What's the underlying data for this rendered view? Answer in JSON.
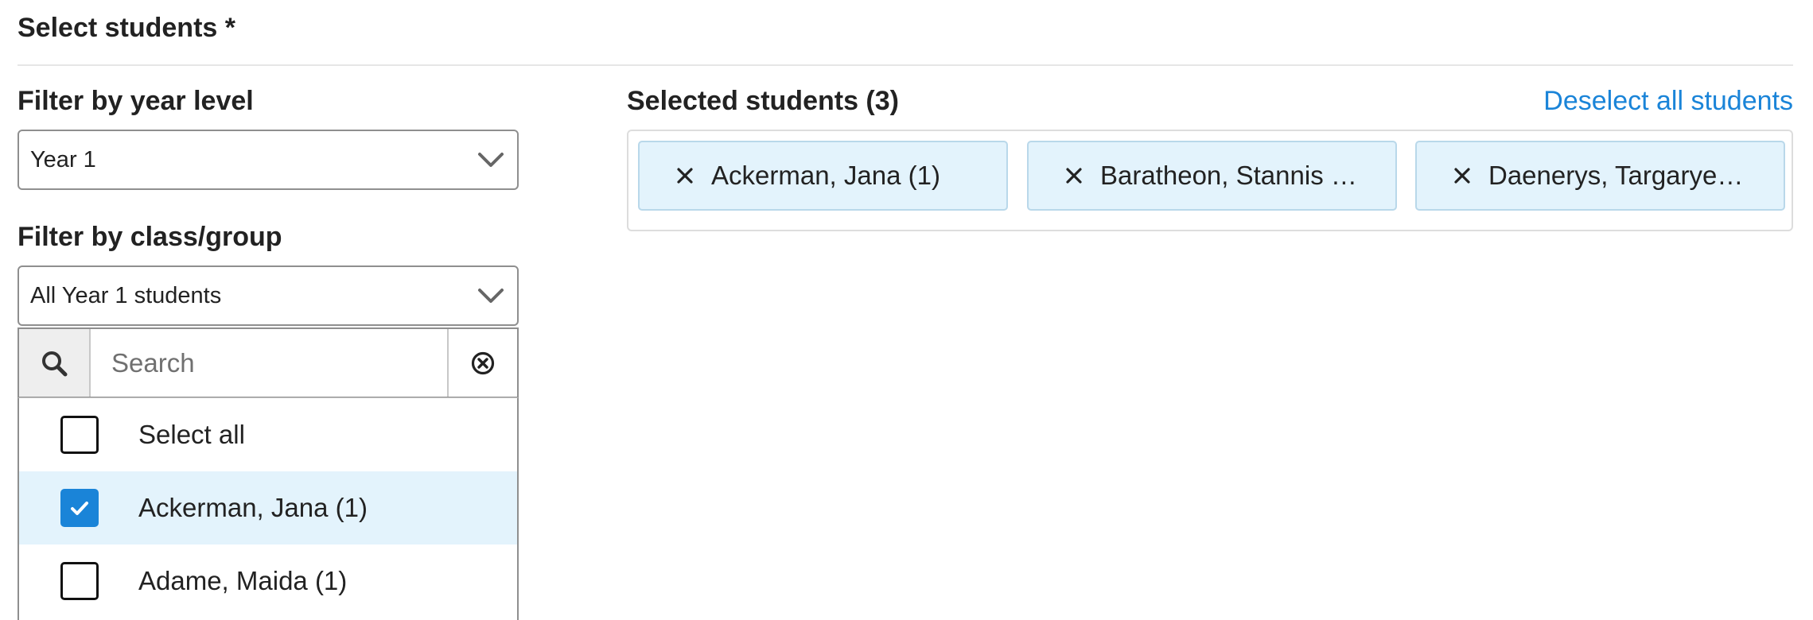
{
  "section": {
    "title": "Select students *"
  },
  "year_filter": {
    "label": "Filter by year level",
    "value": "Year 1"
  },
  "class_filter": {
    "label": "Filter by class/group",
    "value": "All Year 1 students"
  },
  "search": {
    "placeholder": "Search",
    "value": ""
  },
  "student_list": {
    "items": [
      {
        "label": "Select all",
        "checked": false
      },
      {
        "label": "Ackerman, Jana (1)",
        "checked": true
      },
      {
        "label": "Adame, Maida (1)",
        "checked": false
      }
    ]
  },
  "selected": {
    "label": "Selected students (3)",
    "deselect_label": "Deselect all students",
    "chips": [
      {
        "label": "Ackerman, Jana (1)"
      },
      {
        "label": "Baratheon, Stannis …"
      },
      {
        "label": "Daenerys, Targarye…"
      }
    ]
  },
  "colors": {
    "accent": "#1a84d8",
    "selected_bg": "#e3f3fc",
    "border": "#8f8f8f"
  },
  "icons": {
    "search": "search-icon",
    "clear": "clear-circle-icon",
    "chevron": "chevron-down-icon",
    "remove": "close-icon",
    "check": "checkmark-icon"
  }
}
